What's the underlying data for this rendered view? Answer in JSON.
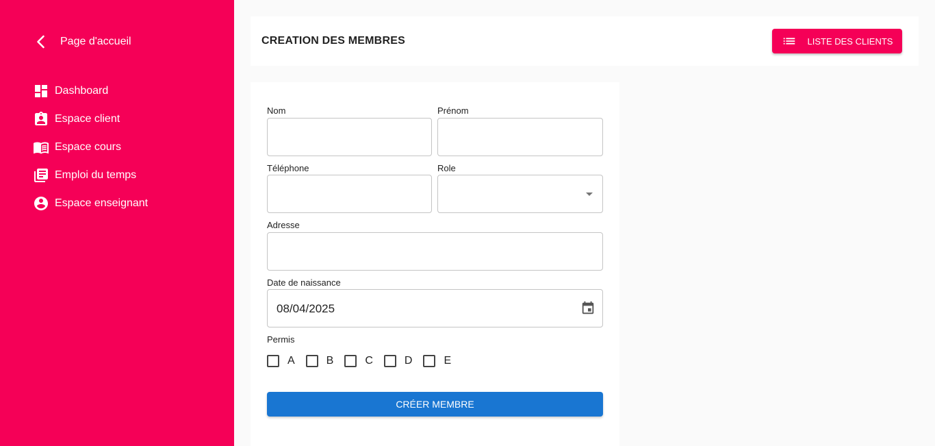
{
  "sidebar": {
    "back_label": "Page d'accueil",
    "items": [
      {
        "label": "Dashboard",
        "icon": "dashboard-icon"
      },
      {
        "label": "Espace client",
        "icon": "assignment-ind-icon"
      },
      {
        "label": "Espace cours",
        "icon": "menu-book-icon"
      },
      {
        "label": "Emploi du temps",
        "icon": "library-books-icon"
      },
      {
        "label": "Espace enseignant",
        "icon": "account-circle-icon"
      }
    ]
  },
  "header": {
    "title": "CREATION DES MEMBRES",
    "list_button": "LISTE DES CLIENTS",
    "list_icon": "list-icon"
  },
  "form": {
    "nom": {
      "label": "Nom",
      "value": ""
    },
    "prenom": {
      "label": "Prénom",
      "value": ""
    },
    "telephone": {
      "label": "Téléphone",
      "value": ""
    },
    "role": {
      "label": "Role",
      "value": ""
    },
    "adresse": {
      "label": "Adresse",
      "value": ""
    },
    "date_naissance": {
      "label": "Date de naissance",
      "value": "08/04/2025",
      "icon": "calendar-icon"
    },
    "permis": {
      "label": "Permis",
      "options": [
        {
          "label": "A",
          "checked": false
        },
        {
          "label": "B",
          "checked": false
        },
        {
          "label": "C",
          "checked": false
        },
        {
          "label": "D",
          "checked": false
        },
        {
          "label": "E",
          "checked": false
        }
      ]
    },
    "submit_label": "CRÉER MEMBRE"
  },
  "colors": {
    "sidebar_bg": "#f50057",
    "accent_pink": "#f50057",
    "submit_blue": "#1976d2",
    "page_bg": "#fafafa"
  }
}
